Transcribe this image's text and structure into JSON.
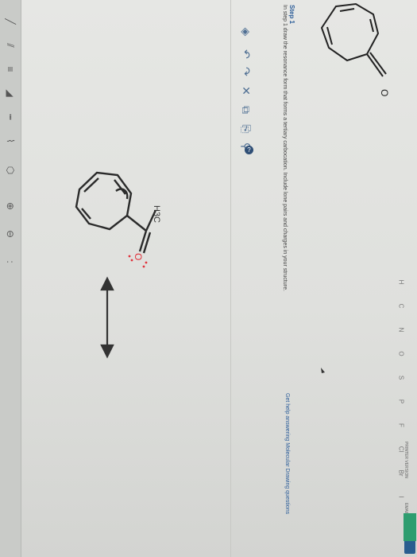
{
  "step": {
    "label": "Step 1"
  },
  "instruction": "In step 1 draw the resonance form that forms a tertiary carbocation. Include lone pairs and charges in your structure.",
  "help_link": "Get help answering Molecular Drawing questions",
  "header": {
    "print_version": "PRINTER VERSION",
    "email": "EMAIL"
  },
  "molecule_top": {
    "atom_o": "O"
  },
  "molecule_drawn": {
    "atom_methyl": "H3C",
    "atom_o": "O"
  },
  "toolbar_icons": [
    "select-icon",
    "undo-icon",
    "redo-icon",
    "erase-icon",
    "copy-icon",
    "paste-icon",
    "zoom-icon",
    "info-icon"
  ],
  "left_tools": [
    "single-bond-icon",
    "double-bond-icon",
    "triple-bond-icon",
    "hash-bond-icon",
    "wedge-bond-icon",
    "chain-icon",
    "charge-plus-icon",
    "charge-minus-icon",
    "lone-pair-icon",
    "ring-icon"
  ],
  "element_palette": [
    "H",
    "C",
    "N",
    "O",
    "S",
    "P",
    "F",
    "Cl",
    "Br",
    "I"
  ],
  "colors": {
    "accent": "#2d5e9a",
    "oxygen": "#e0303a",
    "chat": "#2e9d6f"
  }
}
